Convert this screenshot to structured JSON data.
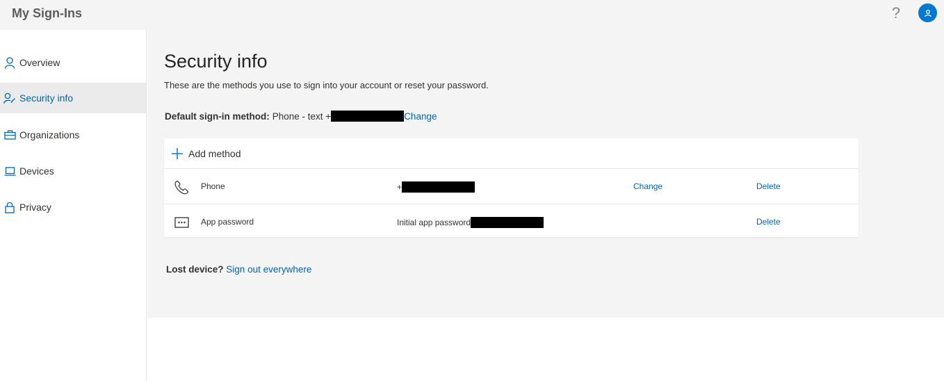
{
  "app": {
    "title": "My Sign-Ins",
    "help_glyph": "?"
  },
  "colors": {
    "accent": "#0078d4",
    "link": "#0064b5",
    "active_bg": "#ebebeb",
    "content_bg": "#f4f4f4"
  },
  "sidebar": {
    "items": [
      {
        "label": "Overview",
        "icon": "person-icon",
        "active": false
      },
      {
        "label": "Security info",
        "icon": "security-info-icon",
        "active": true
      },
      {
        "label": "Organizations",
        "icon": "briefcase-icon",
        "active": false
      },
      {
        "label": "Devices",
        "icon": "laptop-icon",
        "active": false
      },
      {
        "label": "Privacy",
        "icon": "lock-icon",
        "active": false
      }
    ]
  },
  "main": {
    "title": "Security info",
    "subtitle": "These are the methods you use to sign into your account or reset your password.",
    "default_method": {
      "label": "Default sign-in method:",
      "value": "Phone - text +",
      "change_label": "Change"
    },
    "add_method_label": "Add method",
    "methods": [
      {
        "name": "Phone",
        "value": "+",
        "change_label": "Change",
        "delete_label": "Delete",
        "icon": "phone-icon"
      },
      {
        "name": "App password",
        "value": "Initial app password",
        "change_label": "",
        "delete_label": "Delete",
        "icon": "app-password-icon"
      }
    ],
    "lost_device": {
      "question": "Lost device?",
      "link": "Sign out everywhere"
    }
  }
}
